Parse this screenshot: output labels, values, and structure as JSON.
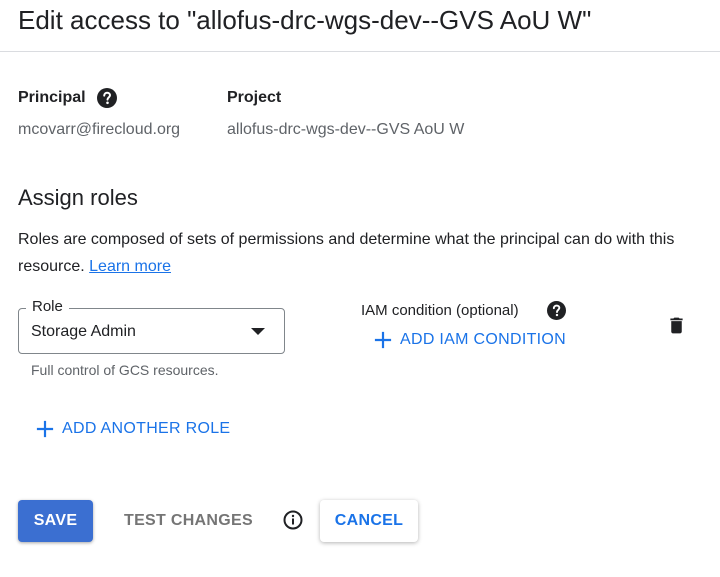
{
  "dialog": {
    "title": "Edit access to \"allofus-drc-wgs-dev--GVS AoU W\""
  },
  "principal": {
    "label": "Principal",
    "value": "mcovarr@firecloud.org",
    "help_icon": "help-circle-icon"
  },
  "project": {
    "label": "Project",
    "value": "allofus-drc-wgs-dev--GVS AoU W"
  },
  "assign_roles": {
    "title": "Assign roles",
    "description": "Roles are composed of sets of permissions and determine what the principal can do with this resource.",
    "learn_more": "Learn more"
  },
  "role": {
    "label": "Role",
    "selected": "Storage Admin",
    "helper": "Full control of GCS resources."
  },
  "iam_condition": {
    "label": "IAM condition (optional)",
    "add_label": "ADD IAM CONDITION"
  },
  "add_another_role": "ADD ANOTHER ROLE",
  "actions": {
    "save": "SAVE",
    "test_changes": "TEST CHANGES",
    "cancel": "CANCEL"
  },
  "colors": {
    "accent": "#1a73e8",
    "save_bg": "#3b6fd1",
    "muted_text": "#5f6368"
  }
}
